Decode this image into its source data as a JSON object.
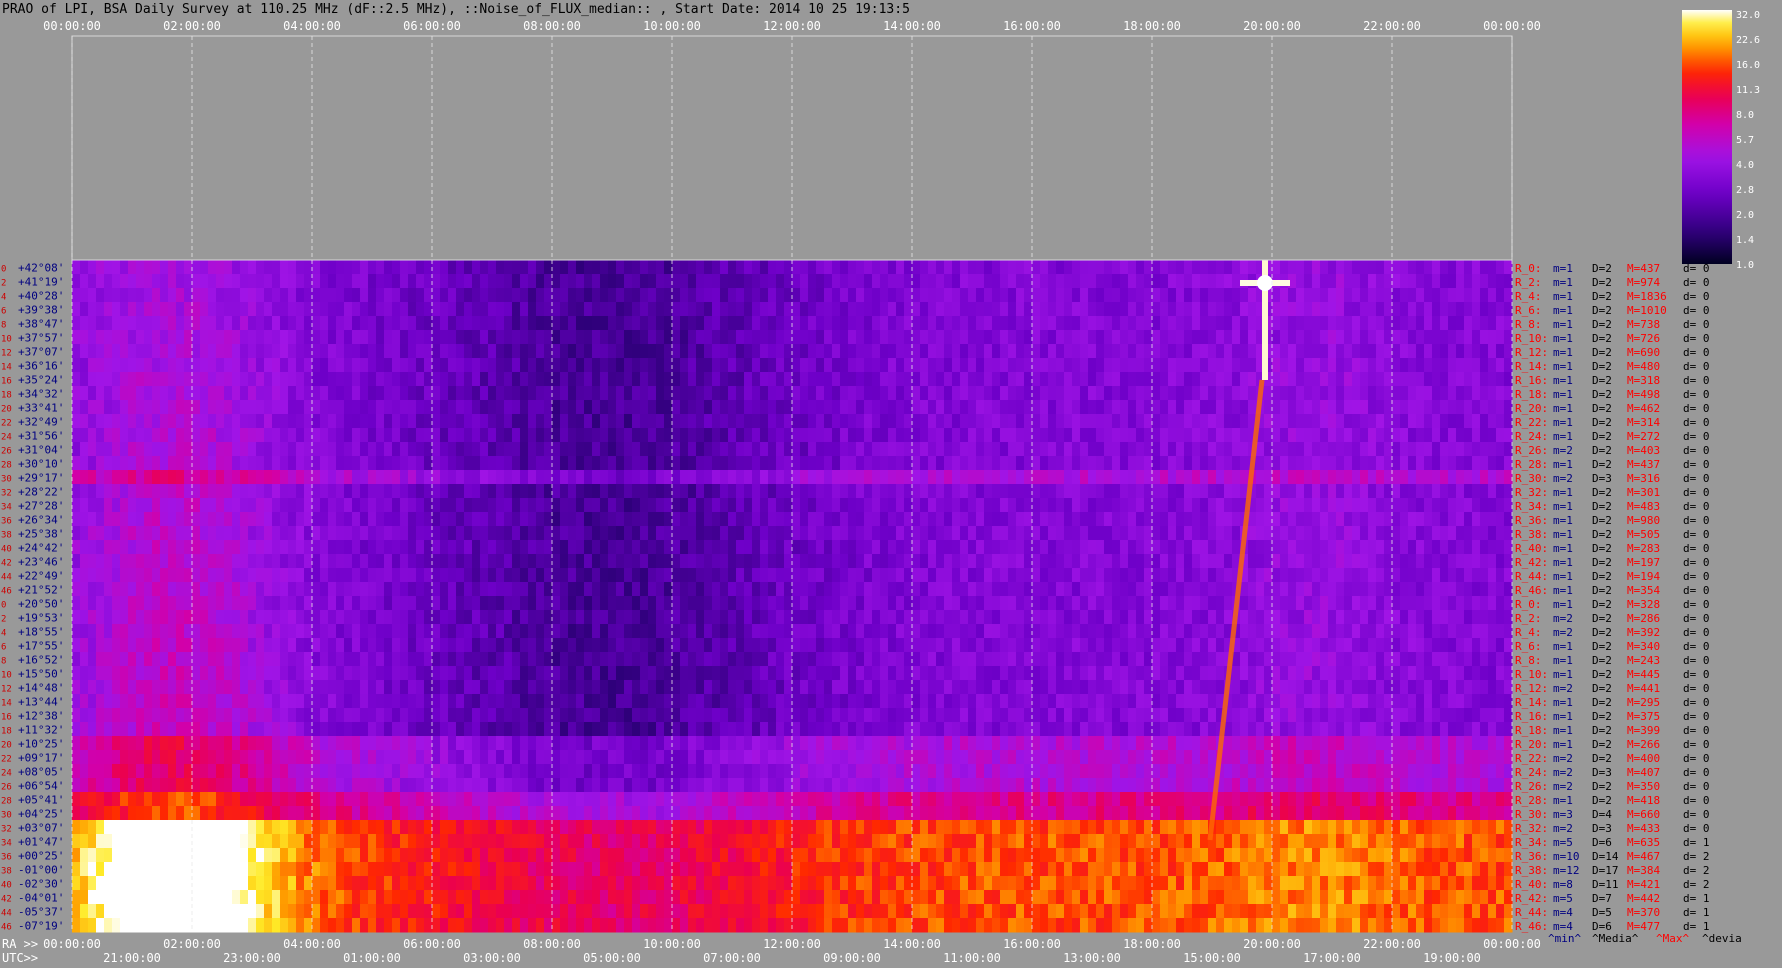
{
  "title": "PRAO of LPI, BSA Daily Survey at 110.25 MHz (dF::2.5 MHz), ::Noise_of_FLUX_median:: , Start Date: 2014 10 25 19:13:5",
  "colors": {
    "background": "#999999",
    "dec_label": "#000080",
    "row_index": "#cc0000",
    "stats_R": "#ff0000",
    "stats_m": "#000080",
    "stats_D": "#000000",
    "stats_M": "#ff0000",
    "stats_d": "#000000"
  },
  "chart_data": {
    "type": "heatmap",
    "top_time_ticks": [
      "00:00:00",
      "02:00:00",
      "04:00:00",
      "06:00:00",
      "08:00:00",
      "10:00:00",
      "12:00:00",
      "14:00:00",
      "16:00:00",
      "18:00:00",
      "20:00:00",
      "22:00:00",
      "00:00:00"
    ],
    "ra_prefix": "RA >>",
    "ra_ticks": [
      "00:00:00",
      "02:00:00",
      "04:00:00",
      "06:00:00",
      "08:00:00",
      "10:00:00",
      "12:00:00",
      "14:00:00",
      "16:00:00",
      "18:00:00",
      "20:00:00",
      "22:00:00",
      "00:00:00"
    ],
    "utc_prefix": "UTC>>",
    "utc_ticks": [
      "21:00:00",
      "23:00:00",
      "01:00:00",
      "03:00:00",
      "05:00:00",
      "07:00:00",
      "09:00:00",
      "11:00:00",
      "13:00:00",
      "15:00:00",
      "17:00:00",
      "19:00:00"
    ],
    "colorbar_ticks": [
      "32.0",
      "22.6",
      "16.0",
      "11.3",
      "8.0",
      "5.7",
      "4.0",
      "2.8",
      "2.0",
      "1.4",
      "1.0"
    ],
    "declinations": [
      "+42°08'",
      "+41°19'",
      "+40°28'",
      "+39°38'",
      "+38°47'",
      "+37°57'",
      "+37°07'",
      "+36°16'",
      "+35°24'",
      "+34°32'",
      "+33°41'",
      "+32°49'",
      "+31°56'",
      "+31°04'",
      "+30°10'",
      "+29°17'",
      "+28°22'",
      "+27°28'",
      "+26°34'",
      "+25°38'",
      "+24°42'",
      "+23°46'",
      "+22°49'",
      "+21°52'",
      "+20°50'",
      "+19°53'",
      "+18°55'",
      "+17°55'",
      "+16°52'",
      "+15°50'",
      "+14°48'",
      "+13°44'",
      "+12°38'",
      "+11°32'",
      "+10°25'",
      "+09°17'",
      "+08°05'",
      "+06°54'",
      "+05°41'",
      "+04°25'",
      "+03°07'",
      "+01°47'",
      "+00°25'",
      "-01°00'",
      "-02°30'",
      "-04°01'",
      "-05°37'",
      "-07°19'"
    ],
    "row_indices": [
      "0",
      "2",
      "4",
      "6",
      "8",
      "10",
      "12",
      "14",
      "16",
      "18",
      "20",
      "22",
      "24",
      "26",
      "28",
      "30",
      "32",
      "34",
      "36",
      "38",
      "40",
      "42",
      "44",
      "46",
      "0",
      "2",
      "4",
      "6",
      "8",
      "10",
      "12",
      "14",
      "16",
      "18",
      "20",
      "22",
      "24",
      "26",
      "28",
      "30",
      "32",
      "34",
      "36",
      "38",
      "40",
      "42",
      "44",
      "46"
    ],
    "channel_stats": [
      {
        "R": "R_0:",
        "m": "m=1",
        "D": "D=2",
        "M": "M=437",
        "d": "d= 0"
      },
      {
        "R": "R_2:",
        "m": "m=1",
        "D": "D=2",
        "M": "M=974",
        "d": "d= 0"
      },
      {
        "R": "R_4:",
        "m": "m=1",
        "D": "D=2",
        "M": "M=1836",
        "d": "d= 0"
      },
      {
        "R": "R_6:",
        "m": "m=1",
        "D": "D=2",
        "M": "M=1010",
        "d": "d= 0"
      },
      {
        "R": "R_8:",
        "m": "m=1",
        "D": "D=2",
        "M": "M=738",
        "d": "d= 0"
      },
      {
        "R": "R_10:",
        "m": "m=1",
        "D": "D=2",
        "M": "M=726",
        "d": "d= 0"
      },
      {
        "R": "R_12:",
        "m": "m=1",
        "D": "D=2",
        "M": "M=690",
        "d": "d= 0"
      },
      {
        "R": "R_14:",
        "m": "m=1",
        "D": "D=2",
        "M": "M=480",
        "d": "d= 0"
      },
      {
        "R": "R_16:",
        "m": "m=1",
        "D": "D=2",
        "M": "M=318",
        "d": "d= 0"
      },
      {
        "R": "R_18:",
        "m": "m=1",
        "D": "D=2",
        "M": "M=498",
        "d": "d= 0"
      },
      {
        "R": "R_20:",
        "m": "m=1",
        "D": "D=2",
        "M": "M=462",
        "d": "d= 0"
      },
      {
        "R": "R_22:",
        "m": "m=1",
        "D": "D=2",
        "M": "M=314",
        "d": "d= 0"
      },
      {
        "R": "R_24:",
        "m": "m=1",
        "D": "D=2",
        "M": "M=272",
        "d": "d= 0"
      },
      {
        "R": "R_26:",
        "m": "m=2",
        "D": "D=2",
        "M": "M=403",
        "d": "d= 0"
      },
      {
        "R": "R_28:",
        "m": "m=1",
        "D": "D=2",
        "M": "M=437",
        "d": "d= 0"
      },
      {
        "R": "R_30:",
        "m": "m=2",
        "D": "D=3",
        "M": "M=316",
        "d": "d= 0"
      },
      {
        "R": "R_32:",
        "m": "m=1",
        "D": "D=2",
        "M": "M=301",
        "d": "d= 0"
      },
      {
        "R": "R_34:",
        "m": "m=1",
        "D": "D=2",
        "M": "M=483",
        "d": "d= 0"
      },
      {
        "R": "R_36:",
        "m": "m=1",
        "D": "D=2",
        "M": "M=980",
        "d": "d= 0"
      },
      {
        "R": "R_38:",
        "m": "m=1",
        "D": "D=2",
        "M": "M=505",
        "d": "d= 0"
      },
      {
        "R": "R_40:",
        "m": "m=1",
        "D": "D=2",
        "M": "M=283",
        "d": "d= 0"
      },
      {
        "R": "R_42:",
        "m": "m=1",
        "D": "D=2",
        "M": "M=197",
        "d": "d= 0"
      },
      {
        "R": "R_44:",
        "m": "m=1",
        "D": "D=2",
        "M": "M=194",
        "d": "d= 0"
      },
      {
        "R": "R_46:",
        "m": "m=1",
        "D": "D=2",
        "M": "M=354",
        "d": "d= 0"
      },
      {
        "R": "R_0:",
        "m": "m=1",
        "D": "D=2",
        "M": "M=328",
        "d": "d= 0"
      },
      {
        "R": "R_2:",
        "m": "m=2",
        "D": "D=2",
        "M": "M=286",
        "d": "d= 0"
      },
      {
        "R": "R_4:",
        "m": "m=2",
        "D": "D=2",
        "M": "M=392",
        "d": "d= 0"
      },
      {
        "R": "R_6:",
        "m": "m=1",
        "D": "D=2",
        "M": "M=340",
        "d": "d= 0"
      },
      {
        "R": "R_8:",
        "m": "m=1",
        "D": "D=2",
        "M": "M=243",
        "d": "d= 0"
      },
      {
        "R": "R_10:",
        "m": "m=1",
        "D": "D=2",
        "M": "M=445",
        "d": "d= 0"
      },
      {
        "R": "R_12:",
        "m": "m=2",
        "D": "D=2",
        "M": "M=441",
        "d": "d= 0"
      },
      {
        "R": "R_14:",
        "m": "m=1",
        "D": "D=2",
        "M": "M=295",
        "d": "d= 0"
      },
      {
        "R": "R_16:",
        "m": "m=1",
        "D": "D=2",
        "M": "M=375",
        "d": "d= 0"
      },
      {
        "R": "R_18:",
        "m": "m=1",
        "D": "D=2",
        "M": "M=399",
        "d": "d= 0"
      },
      {
        "R": "R_20:",
        "m": "m=1",
        "D": "D=2",
        "M": "M=266",
        "d": "d= 0"
      },
      {
        "R": "R_22:",
        "m": "m=2",
        "D": "D=2",
        "M": "M=400",
        "d": "d= 0"
      },
      {
        "R": "R_24:",
        "m": "m=2",
        "D": "D=3",
        "M": "M=407",
        "d": "d= 0"
      },
      {
        "R": "R_26:",
        "m": "m=2",
        "D": "D=2",
        "M": "M=350",
        "d": "d= 0"
      },
      {
        "R": "R_28:",
        "m": "m=1",
        "D": "D=2",
        "M": "M=418",
        "d": "d= 0"
      },
      {
        "R": "R_30:",
        "m": "m=3",
        "D": "D=4",
        "M": "M=660",
        "d": "d= 0"
      },
      {
        "R": "R_32:",
        "m": "m=2",
        "D": "D=3",
        "M": "M=433",
        "d": "d= 0"
      },
      {
        "R": "R_34:",
        "m": "m=5",
        "D": "D=6",
        "M": "M=635",
        "d": "d= 1"
      },
      {
        "R": "R_36:",
        "m": "m=10",
        "D": "D=14",
        "M": "M=467",
        "d": "d= 2"
      },
      {
        "R": "R_38:",
        "m": "m=12",
        "D": "D=17",
        "M": "M=384",
        "d": "d= 2"
      },
      {
        "R": "R_40:",
        "m": "m=8",
        "D": "D=11",
        "M": "M=421",
        "d": "d= 2"
      },
      {
        "R": "R_42:",
        "m": "m=5",
        "D": "D=7",
        "M": "M=442",
        "d": "d= 1"
      },
      {
        "R": "R_44:",
        "m": "m=4",
        "D": "D=5",
        "M": "M=370",
        "d": "d= 1"
      },
      {
        "R": "R_46:",
        "m": "m=4",
        "D": "D=6",
        "M": "M=477",
        "d": "d= 1"
      }
    ],
    "stats_legend": [
      "^min^",
      "^Media^",
      "^Max^",
      "^devia"
    ]
  }
}
